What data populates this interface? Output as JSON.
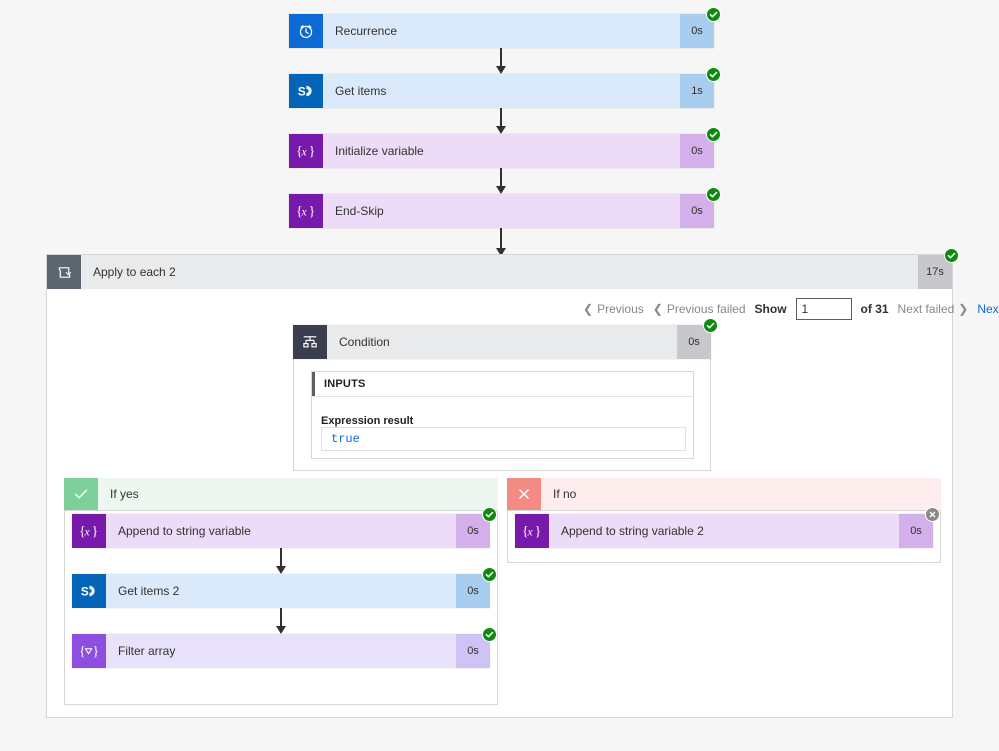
{
  "flow": {
    "top_actions": [
      {
        "name": "Recurrence",
        "icon": "clock-icon",
        "theme": "t-blue",
        "duration": "0s",
        "status": "succeeded"
      },
      {
        "name": "Get items",
        "icon": "sharepoint-icon",
        "theme": "t-sp",
        "duration": "1s",
        "status": "succeeded"
      },
      {
        "name": "Initialize variable",
        "icon": "variable-icon",
        "theme": "t-var",
        "duration": "0s",
        "status": "succeeded"
      },
      {
        "name": "End-Skip",
        "icon": "variable-icon",
        "theme": "t-var",
        "duration": "0s",
        "status": "succeeded"
      }
    ],
    "scope": {
      "name": "Apply to each 2",
      "icon": "loop-icon",
      "duration": "17s",
      "status": "succeeded",
      "pagination": {
        "previous_label": "Previous",
        "previous_failed_label": "Previous failed",
        "show_label": "Show",
        "show_value": "1",
        "of_label": "of 31",
        "next_failed_label": "Next failed",
        "next_label": "Next"
      },
      "condition": {
        "name": "Condition",
        "icon": "condition-icon",
        "duration": "0s",
        "status": "succeeded",
        "inputs_header": "INPUTS",
        "expression_label": "Expression result",
        "expression_value": "true"
      },
      "branch_yes": {
        "label": "If yes",
        "icon": "check-icon",
        "actions": [
          {
            "name": "Append to string variable",
            "icon": "variable-icon",
            "theme": "t-var",
            "duration": "0s",
            "status": "succeeded"
          },
          {
            "name": "Get items 2",
            "icon": "sharepoint-icon",
            "theme": "t-sp",
            "duration": "0s",
            "status": "succeeded"
          },
          {
            "name": "Filter array",
            "icon": "filter-icon",
            "theme": "t-var2",
            "duration": "0s",
            "status": "succeeded"
          }
        ]
      },
      "branch_no": {
        "label": "If no",
        "icon": "x-icon",
        "actions": [
          {
            "name": "Append to string variable 2",
            "icon": "variable-icon",
            "theme": "t-var",
            "duration": "0s",
            "status": "skipped"
          }
        ]
      }
    }
  },
  "colors": {
    "background": "#f6f6f6",
    "success": "#0f8a10",
    "skipped": "#8a8886",
    "accent": "#0b6ad4",
    "yes_green": "#7ed09a",
    "no_red": "#f48a84"
  }
}
